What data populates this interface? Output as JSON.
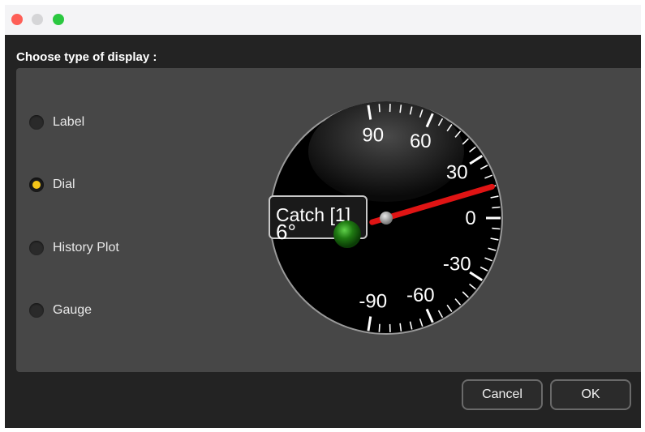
{
  "dialog": {
    "heading": "Choose type of display :",
    "options": [
      {
        "label": "Label",
        "selected": false
      },
      {
        "label": "Dial",
        "selected": true
      },
      {
        "label": "History Plot",
        "selected": false
      },
      {
        "label": "Gauge",
        "selected": false
      }
    ],
    "buttons": {
      "cancel": "Cancel",
      "ok": "OK"
    }
  },
  "dial": {
    "tick_labels": [
      "90",
      "60",
      "30",
      "0",
      "-30",
      "-60",
      "-90"
    ],
    "needle_value": 15,
    "caption_title": "Catch [1]",
    "caption_value": "6°",
    "colors": {
      "needle": "#e01414",
      "face": "#000000",
      "indicator": "#1f7a12"
    }
  }
}
